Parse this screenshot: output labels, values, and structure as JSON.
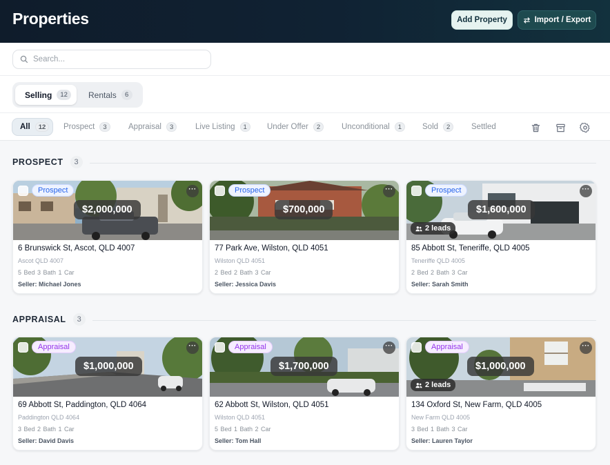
{
  "header": {
    "title": "Properties",
    "add_label": "Add Property",
    "import_label": "Import / Export"
  },
  "search": {
    "placeholder": "Search..."
  },
  "segments": [
    {
      "label": "Selling",
      "count": "12"
    },
    {
      "label": "Rentals",
      "count": "6"
    }
  ],
  "filters": [
    {
      "label": "All",
      "count": "12"
    },
    {
      "label": "Prospect",
      "count": "3"
    },
    {
      "label": "Appraisal",
      "count": "3"
    },
    {
      "label": "Live Listing",
      "count": "1"
    },
    {
      "label": "Under Offer",
      "count": "2"
    },
    {
      "label": "Unconditional",
      "count": "1"
    },
    {
      "label": "Sold",
      "count": "2"
    },
    {
      "label": "Settled",
      "count": ""
    }
  ],
  "tool_icons": [
    "trash-icon",
    "archive-icon",
    "settings-icon"
  ],
  "sections": [
    {
      "title": "PROSPECT",
      "count": "3",
      "cards": [
        {
          "stage": "Prospect",
          "price": "$2,000,000",
          "leads": "",
          "address": "6 Brunswick St, Ascot, QLD 4007",
          "suburb": "Ascot QLD 4007",
          "specs": "5 Bed  3 Bath  1 Car",
          "seller": "Seller: Michael Jones"
        },
        {
          "stage": "Prospect",
          "price": "$700,000",
          "leads": "",
          "address": "77 Park Ave, Wilston, QLD 4051",
          "suburb": "Wilston QLD 4051",
          "specs": "2 Bed  2 Bath  3 Car",
          "seller": "Seller: Jessica Davis"
        },
        {
          "stage": "Prospect",
          "price": "$1,600,000",
          "leads": "2 leads",
          "address": "85 Abbott St, Teneriffe, QLD 4005",
          "suburb": "Teneriffe QLD 4005",
          "specs": "2 Bed  2 Bath  3 Car",
          "seller": "Seller: Sarah Smith"
        }
      ]
    },
    {
      "title": "APPRAISAL",
      "count": "3",
      "cards": [
        {
          "stage": "Appraisal",
          "price": "$1,000,000",
          "leads": "",
          "address": "69 Abbott St, Paddington, QLD 4064",
          "suburb": "Paddington QLD 4064",
          "specs": "3 Bed  2 Bath  1 Car",
          "seller": "Seller: David Davis"
        },
        {
          "stage": "Appraisal",
          "price": "$1,700,000",
          "leads": "",
          "address": "62 Abbott St, Wilston, QLD 4051",
          "suburb": "Wilston QLD 4051",
          "specs": "5 Bed  1 Bath  2 Car",
          "seller": "Seller: Tom Hall"
        },
        {
          "stage": "Appraisal",
          "price": "$1,000,000",
          "leads": "2 leads",
          "address": "134 Oxford St, New Farm, QLD 4005",
          "suburb": "New Farm QLD 4005",
          "specs": "3 Bed  1 Bath  3 Car",
          "seller": "Seller: Lauren Taylor"
        }
      ]
    }
  ]
}
